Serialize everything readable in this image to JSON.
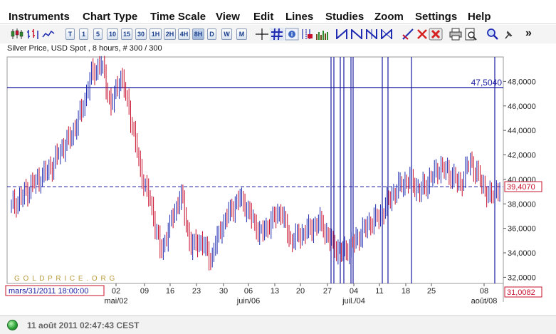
{
  "menu": {
    "items": [
      "Instruments",
      "Chart Type",
      "Time Scale",
      "View",
      "Edit",
      "Lines",
      "Studies",
      "Zoom",
      "Settings",
      "Help"
    ]
  },
  "toolbar": {
    "period_buttons": [
      "T",
      "1",
      "5",
      "10",
      "15",
      "30",
      "1H",
      "2H",
      "4H",
      "8H",
      "D",
      "W",
      "M"
    ],
    "overflow_label": "»"
  },
  "chart_title": "Silver Price, USD Spot , 8 hours, # 300 / 300",
  "watermark": "G O L D P R I C E . O R G",
  "status": {
    "timestamp": "11 août 2011 02:47:43 CEST"
  },
  "colors": {
    "up": "#1f2bb0",
    "down": "#c8102e",
    "grid_line": "#1a1aa0",
    "price_label": "#c8102e",
    "horizontal_line_label": "#1a1aa0"
  },
  "chart_data": {
    "type": "ohlc",
    "title": "Silver Price, USD Spot , 8 hours, # 300 / 300",
    "y_axis": {
      "ticks": [
        "48,0000",
        "46,0000",
        "44,0000",
        "42,0000",
        "40,0000",
        "38,0000",
        "36,0000",
        "34,0000",
        "32,0000"
      ],
      "min": 31.5,
      "max": 50.0
    },
    "x_axis": {
      "ticks": [
        "02",
        "09",
        "16",
        "23",
        "30",
        "06",
        "13",
        "20",
        "27",
        "04",
        "11",
        "18",
        "25",
        "08"
      ],
      "month_labels": [
        "mai/02",
        "juin/06",
        "juil./04",
        "août/08"
      ]
    },
    "horizontal_line": {
      "value": 47.504,
      "label": "47,5040"
    },
    "current_price": {
      "value": 39.407,
      "label": "39,4070"
    },
    "crosshair": {
      "date_label": "mars/31/2011 18:00:00",
      "price_label": "31,0082"
    },
    "close_series": [
      37.8,
      38.5,
      39.5,
      40.2,
      41.0,
      42.5,
      43.5,
      45.5,
      48.5,
      49.5,
      46.0,
      48.5,
      45.0,
      40.5,
      38.0,
      34.0,
      36.5,
      38.8,
      34.5,
      35.0,
      33.5,
      36.0,
      37.5,
      38.5,
      37.0,
      35.5,
      36.5,
      37.5,
      35.0,
      35.5,
      36.0,
      36.5,
      35.0,
      34.0,
      34.5,
      35.5,
      36.5,
      37.0,
      38.5,
      39.5,
      40.0,
      39.0,
      40.0,
      41.0,
      40.5,
      39.5,
      41.5,
      40.0,
      38.5,
      39.4
    ],
    "vertical_markers": [
      "27",
      "01",
      "04",
      "11",
      "13",
      "18",
      "08"
    ]
  }
}
